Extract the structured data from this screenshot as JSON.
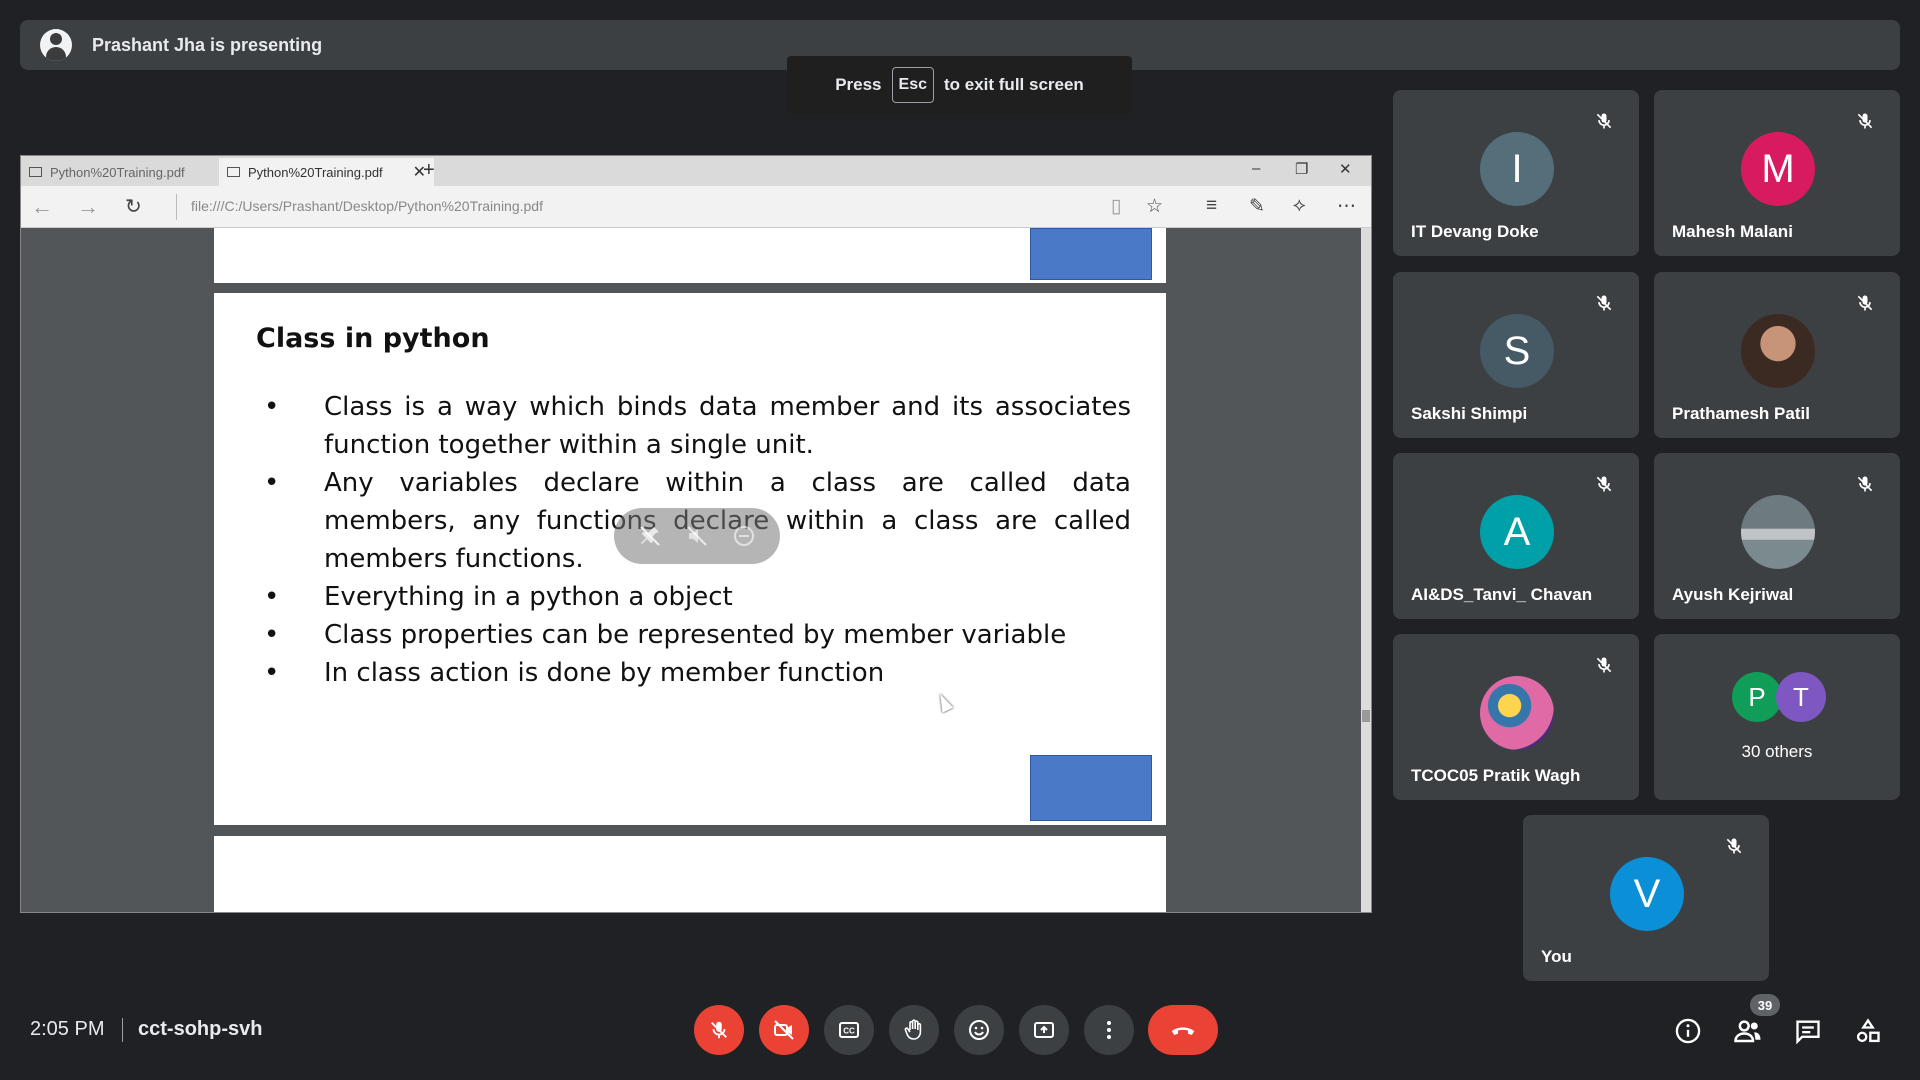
{
  "presenting": {
    "text": "Prashant Jha is presenting"
  },
  "fullscreen_hint": {
    "press": "Press",
    "key": "Esc",
    "rest": "to exit full screen"
  },
  "browser": {
    "tabs": [
      {
        "label": "Python%20Training.pdf"
      },
      {
        "label": "Python%20Training.pdf"
      }
    ],
    "close_glyph": "✕",
    "new_tab_glyph": "+",
    "url": "file:///C:/Users/Prashant/Desktop/Python%20Training.pdf"
  },
  "slide": {
    "title": "Class in python",
    "bullets": [
      "Class is a way which binds data member and its associates function together within a single unit.",
      "Any variables declare within a class are called data members, any functions declare within a class are called members functions.",
      "Everything in a python a object",
      "Class properties can be represented by member variable",
      "In class action is done by member function"
    ]
  },
  "participants": [
    {
      "name": "IT Devang Doke",
      "initial": "I",
      "color": "#546e7a",
      "muted": true
    },
    {
      "name": "Mahesh Malani",
      "initial": "M",
      "color": "#d81b60",
      "muted": true
    },
    {
      "name": "Sakshi Shimpi",
      "initial": "S",
      "color": "#455a64",
      "muted": true
    },
    {
      "name": "Prathamesh Patil",
      "initial": "",
      "color": "#6d4c41",
      "muted": true
    },
    {
      "name": "AI&DS_Tanvi_ Chavan",
      "initial": "A",
      "color": "#00a0a8",
      "muted": true
    },
    {
      "name": "Ayush Kejriwal",
      "initial": "",
      "color": "#8d8d8d",
      "muted": true
    },
    {
      "name": "TCOC05 Pratik Wagh",
      "initial": "",
      "color": "#7c4dff",
      "muted": true
    }
  ],
  "others": {
    "label": "30 others",
    "avatars": [
      {
        "initial": "P",
        "color": "#0f9d58"
      },
      {
        "initial": "T",
        "color": "#7e57c2"
      }
    ]
  },
  "self_tile": {
    "name": "You",
    "initial": "V",
    "color": "#0b8fd6",
    "muted": true
  },
  "bottom": {
    "time": "2:05 PM",
    "meeting_code": "cct-sohp-svh",
    "people_count": "39"
  },
  "colors": {
    "background": "#202124",
    "tile": "#3c4043",
    "danger": "#ea4335",
    "slide_accent_box": "#4a7ac7"
  },
  "icons": [
    "mic-off-icon",
    "camera-off-icon",
    "captions-icon",
    "raise-hand-icon",
    "emoji-icon",
    "present-icon",
    "more-options-icon",
    "hangup-icon",
    "info-icon",
    "people-icon",
    "chat-icon",
    "activities-icon"
  ]
}
